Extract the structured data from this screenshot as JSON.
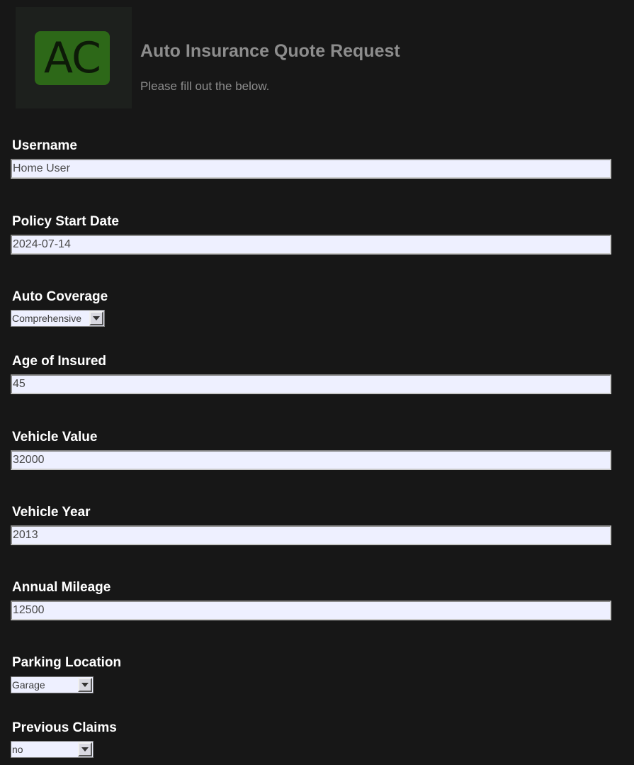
{
  "header": {
    "logo_text": "AC",
    "title": "Auto Insurance Quote Request",
    "subtitle": "Please fill out the below."
  },
  "form": {
    "username": {
      "label": "Username",
      "value": "Home User"
    },
    "policy_start_date": {
      "label": "Policy Start Date",
      "value": "2024-07-14"
    },
    "auto_coverage": {
      "label": "Auto Coverage",
      "selected": "Comprehensive"
    },
    "age_of_insured": {
      "label": "Age of Insured",
      "value": "45"
    },
    "vehicle_value": {
      "label": "Vehicle Value",
      "value": "32000"
    },
    "vehicle_year": {
      "label": "Vehicle Year",
      "value": "2013"
    },
    "annual_mileage": {
      "label": "Annual Mileage",
      "value": "12500"
    },
    "parking_location": {
      "label": "Parking Location",
      "selected": "Garage"
    },
    "previous_claims": {
      "label": "Previous Claims",
      "selected": "no"
    }
  },
  "colors": {
    "background": "#171717",
    "logo_green": "#2d6818",
    "input_bg": "#eef0ff",
    "title_gray": "#8d8d8d"
  }
}
